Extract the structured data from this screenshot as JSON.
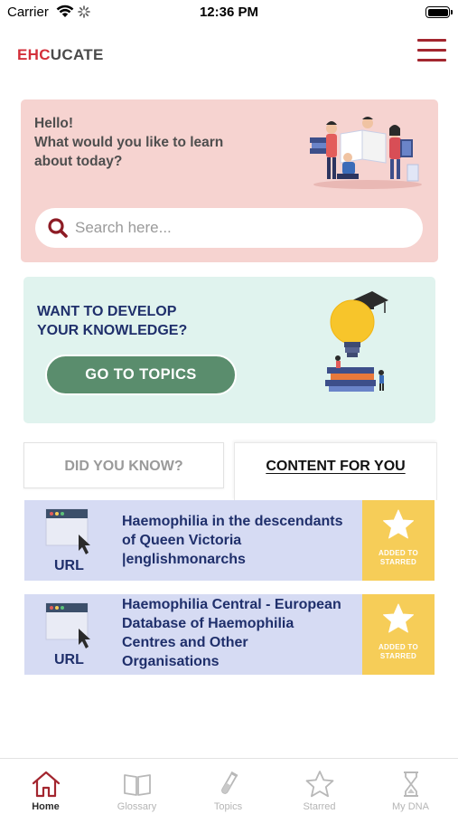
{
  "status_bar": {
    "carrier": "Carrier",
    "time": "12:36 PM"
  },
  "header": {
    "logo_part1": "EHC",
    "logo_part2": "UCATE",
    "menu_icon": "hamburger-icon"
  },
  "greeting": {
    "line1": "Hello!",
    "line2": "What would you like to learn about today?",
    "search_placeholder": "Search here..."
  },
  "develop": {
    "title_line1": "WANT TO DEVELOP",
    "title_line2": "YOUR KNOWLEDGE?",
    "button": "GO TO TOPICS"
  },
  "tabs": [
    {
      "label": "DID YOU KNOW?",
      "active": false
    },
    {
      "label": "CONTENT FOR YOU",
      "active": true
    }
  ],
  "content_items": [
    {
      "type": "URL",
      "title": "Haemophilia in the descendants of Queen Victoria |englishmonarchs",
      "starred_label": "ADDED TO STARRED"
    },
    {
      "type": "URL",
      "title": "Haemophilia Central - European Database of Haemophilia Centres and Other Organisations",
      "starred_label": "ADDED TO STARRED"
    }
  ],
  "bottom_nav": [
    {
      "label": "Home",
      "icon": "home-icon",
      "active": true
    },
    {
      "label": "Glossary",
      "icon": "book-icon",
      "active": false
    },
    {
      "label": "Topics",
      "icon": "flask-icon",
      "active": false
    },
    {
      "label": "Starred",
      "icon": "star-icon",
      "active": false
    },
    {
      "label": "My DNA",
      "icon": "hourglass-icon",
      "active": false
    }
  ],
  "colors": {
    "brand_red": "#d32f3a",
    "menu_red": "#a3262f",
    "greeting_bg": "#f6d3d0",
    "develop_bg": "#e0f3ee",
    "button_green": "#5a8d6d",
    "card_bg": "#d6dbf3",
    "star_bg": "#f6cd58",
    "navy_text": "#1f2f6b"
  }
}
